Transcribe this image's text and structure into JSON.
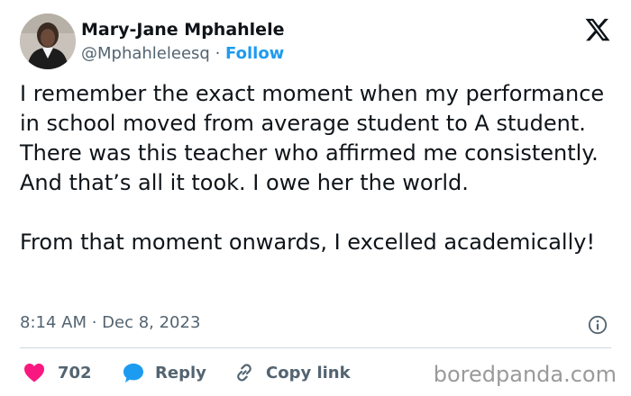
{
  "author": {
    "display_name": "Mary-Jane Mphahlele",
    "handle": "@Mphahleleesq",
    "separator": "·",
    "follow_label": "Follow"
  },
  "tweet": {
    "paragraphs": [
      "I remember the exact moment when my performance in school moved from average student to A student. There was this teacher who affirmed me consistently. And that’s all it took. I owe her the world.",
      "From that moment onwards, I excelled academically!"
    ],
    "timestamp": "8:14 AM · Dec 8, 2023"
  },
  "actions": {
    "like_count": "702",
    "reply_label": "Reply",
    "copy_link_label": "Copy link"
  },
  "watermark": "boredpanda.com",
  "icons": {
    "logo": "x-logo-icon",
    "info": "info-icon",
    "like": "heart-icon",
    "reply": "speech-bubble-icon",
    "copy": "link-icon"
  },
  "colors": {
    "text": "#0f1419",
    "secondary": "#536471",
    "accent": "#1d9bf0",
    "like": "#f91880",
    "divider": "#cfd9de"
  }
}
